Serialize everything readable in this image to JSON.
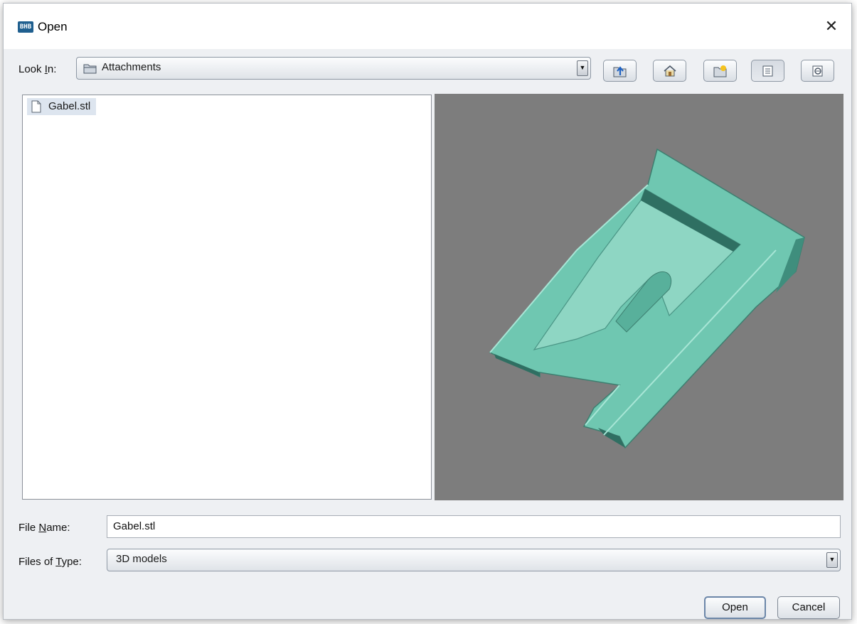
{
  "window": {
    "title": "Open",
    "app_icon_text": "BHB"
  },
  "toolbar": {
    "look_in_label": "Look In:",
    "look_in_value": "Attachments",
    "buttons": [
      "up-one-level",
      "home",
      "new-folder",
      "list-view",
      "details-view"
    ]
  },
  "files": [
    {
      "name": "Gabel.stl",
      "icon": "file-icon"
    }
  ],
  "form": {
    "file_name_label": "File Name:",
    "file_name_value": "Gabel.stl",
    "file_type_label": "Files of Type:",
    "file_type_value": "3D models"
  },
  "actions": {
    "open_label": "Open",
    "cancel_label": "Cancel"
  },
  "colors": {
    "preview_background": "#7d7d7d",
    "model_color": "#6fc7b1",
    "selection": "#dde5ef"
  }
}
